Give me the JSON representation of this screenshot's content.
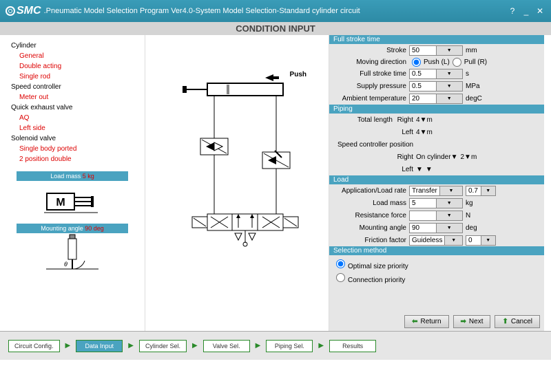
{
  "title": ".Pneumatic Model Selection Program Ver4.0-System Model Selection-Standard cylinder circuit",
  "logo": "SMC",
  "header": "CONDITION INPUT",
  "tree": [
    {
      "label": "Cylinder",
      "cls": "black"
    },
    {
      "label": "General",
      "cls": "red"
    },
    {
      "label": "Double acting",
      "cls": "red"
    },
    {
      "label": "Single rod",
      "cls": "red"
    },
    {
      "label": "Speed controller",
      "cls": "black"
    },
    {
      "label": "Meter out",
      "cls": "red"
    },
    {
      "label": "Quick exhaust valve",
      "cls": "black"
    },
    {
      "label": "AQ",
      "cls": "red"
    },
    {
      "label": "Left side",
      "cls": "red"
    },
    {
      "label": "Solenoid valve",
      "cls": "black"
    },
    {
      "label": "Single body ported",
      "cls": "red"
    },
    {
      "label": "2 position double",
      "cls": "red"
    }
  ],
  "loadmass_bar": "Load mass",
  "loadmass_val": "5 kg",
  "mountangle_bar": "Mounting angle",
  "mountangle_val": "90 deg",
  "push_label": "Push",
  "sections": {
    "fullstroke": "Full stroke time",
    "piping": "Piping",
    "load": "Load",
    "selmethod": "Selection method"
  },
  "fields": {
    "stroke_lbl": "Stroke",
    "stroke_val": "50",
    "stroke_unit": "mm",
    "movedir_lbl": "Moving direction",
    "movedir_push": "Push (L)",
    "movedir_pull": "Pull (R)",
    "fulltime_lbl": "Full stroke time",
    "fulltime_val": "0.5",
    "fulltime_unit": "s",
    "supply_lbl": "Supply pressure",
    "supply_val": "0.5",
    "supply_unit": "MPa",
    "ambient_lbl": "Ambient temperature",
    "ambient_val": "20",
    "ambient_unit": "degC",
    "totlen_lbl": "Total length",
    "right_lbl": "Right",
    "left_lbl": "Left",
    "totlen_r": "4",
    "totlen_l": "4",
    "len_unit": "m",
    "scpos_lbl": "Speed controller position",
    "scpos_r": "On cylinder",
    "scpos_r2": "2",
    "scpos_unit": "m",
    "scpos_l": "",
    "apprate_lbl": "Application/Load rate",
    "apprate_val": "Transfer",
    "apprate_val2": "0.7",
    "loadmass_lbl": "Load mass",
    "loadmass_val": "5",
    "loadmass_unit": "kg",
    "resist_lbl": "Resistance force",
    "resist_val": "",
    "resist_unit": "N",
    "mount_lbl": "Mounting angle",
    "mount_val": "90",
    "mount_unit": "deg",
    "fric_lbl": "Friction factor",
    "fric_val": "Guideless",
    "fric_val2": "0"
  },
  "selmethod": {
    "opt1": "Optimal size priority",
    "opt2": "Connection priority"
  },
  "buttons": {
    "return": "Return",
    "next": "Next",
    "cancel": "Cancel"
  },
  "steps": [
    "Circuit Config.",
    "Data Input",
    "Cylinder Sel.",
    "Valve Sel.",
    "Piping Sel.",
    "Results"
  ],
  "active_step": 1
}
